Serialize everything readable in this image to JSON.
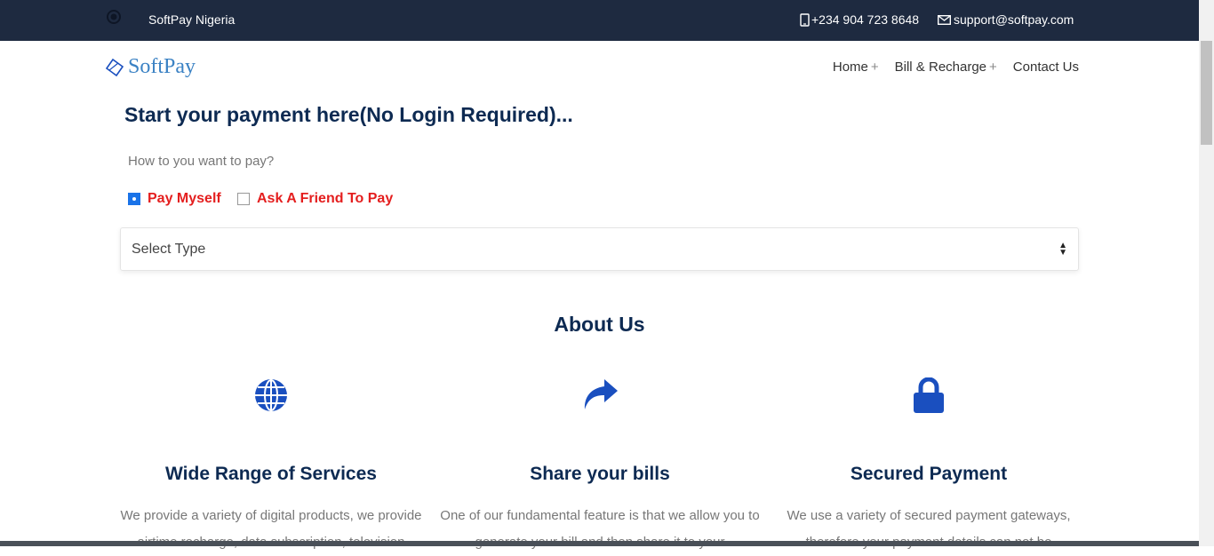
{
  "topbar": {
    "brand": "SoftPay Nigeria",
    "phone": "+234 904 723 8648",
    "email": "support@softpay.com"
  },
  "nav": {
    "logo": "SoftPay",
    "items": [
      {
        "label": "Home",
        "plus": "+"
      },
      {
        "label": "Bill & Recharge",
        "plus": "+"
      },
      {
        "label": "Contact Us"
      }
    ]
  },
  "form": {
    "title": "Start your payment here(No Login Required)...",
    "prompt": "How to you want to pay?",
    "options": [
      {
        "label": "Pay Myself",
        "checked": true
      },
      {
        "label": "Ask A Friend To Pay",
        "checked": false
      }
    ],
    "select_value": "Select Type"
  },
  "about": {
    "title": "About Us",
    "features": [
      {
        "icon": "globe-icon",
        "title": "Wide Range of Services",
        "text": "We provide a variety of digital products, we provide airtime recharge, data subscription, television"
      },
      {
        "icon": "share-icon",
        "title": "Share your bills",
        "text": "One of our fundamental feature is that we allow you to generate your bill and then share it to your"
      },
      {
        "icon": "lock-icon",
        "title": "Secured Payment",
        "text": "We use a variety of secured payment gateways, therefore your payment details can not be"
      }
    ]
  },
  "colors": {
    "topbar": "#1e2a40",
    "heading": "#0d2a52",
    "accent": "#1a4fbf",
    "option": "#e41e1e"
  }
}
